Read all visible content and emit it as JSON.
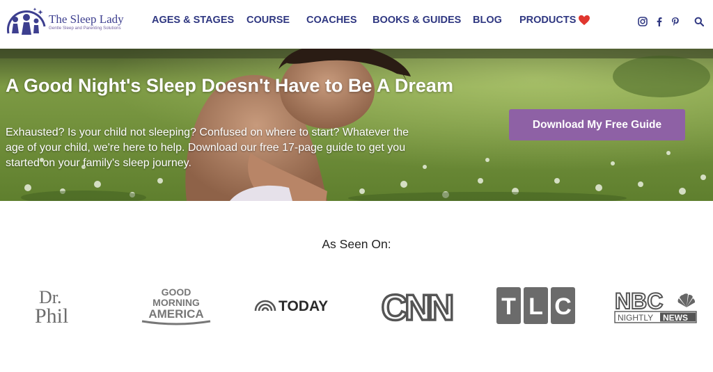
{
  "brand": {
    "name": "The Sleep Lady",
    "tagline": "Gentle Sleep and Parenting Solutions",
    "color": "#3d3f8f"
  },
  "nav": {
    "items": [
      {
        "label": "AGES & STAGES"
      },
      {
        "label": "COURSE"
      },
      {
        "label": "COACHES"
      },
      {
        "label": "BOOKS & GUIDES"
      },
      {
        "label": "BLOG"
      },
      {
        "label": "PRODUCTS"
      }
    ],
    "products_icon": "heart-icon",
    "color": "#2f3781"
  },
  "social": [
    "instagram-icon",
    "facebook-icon",
    "pinterest-icon",
    "search-icon"
  ],
  "hero": {
    "title": "A Good Night's Sleep Doesn't Have to Be A Dream",
    "subtitle": "Exhausted? Is your child not sleeping? Confused on where to start? Whatever the age of your child, we're here to help. Download our free 17-page guide to get you started on your family's sleep journey.",
    "cta_label": "Download My Free Guide",
    "cta_color": "#8e61a5"
  },
  "as_seen_on": {
    "heading": "As Seen On:",
    "logos": [
      {
        "name": "drphil-logo",
        "line1": "Dr.",
        "line2": "Phil"
      },
      {
        "name": "gma-logo",
        "line1": "GOOD",
        "line2": "MORNING",
        "line3": "AMERICA"
      },
      {
        "name": "today-logo",
        "text": "TODAY"
      },
      {
        "name": "cnn-logo",
        "text": "CNN"
      },
      {
        "name": "tlc-logo",
        "letters": [
          "T",
          "L",
          "C"
        ]
      },
      {
        "name": "nbc-logo",
        "text": "NBC",
        "sub1": "NIGHTLY",
        "sub2": "NEWS"
      }
    ]
  }
}
